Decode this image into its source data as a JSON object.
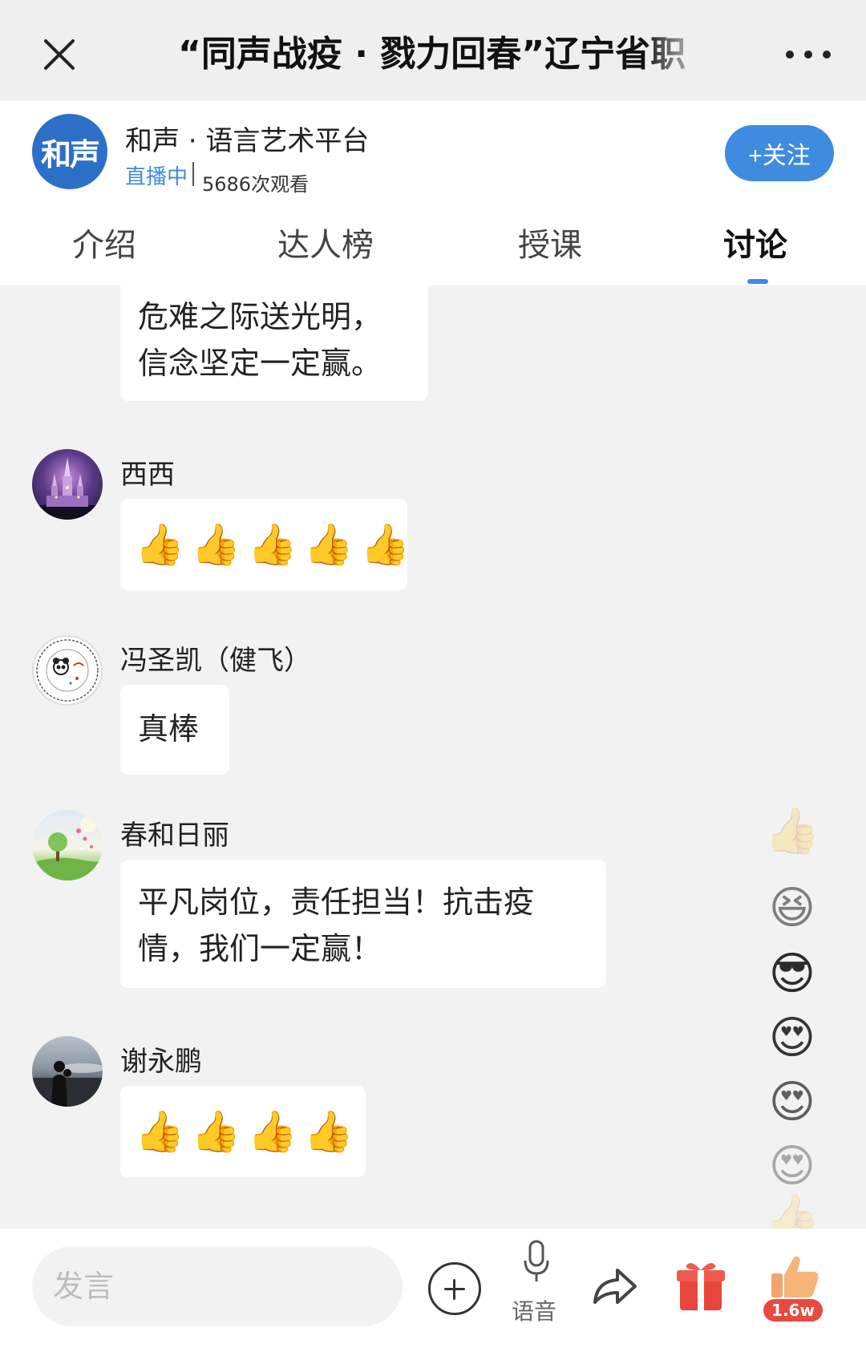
{
  "header": {
    "title": "“同声战疫 · 戮力回春”辽宁省职",
    "close_icon": "close-icon",
    "more_icon": "more-icon"
  },
  "channel": {
    "logo_text": "和声",
    "name": "和声 · 语言艺术平台",
    "live_status": "直播中",
    "views": "5686次观看",
    "follow_label": "+关注",
    "accent_color": "#3e8be0"
  },
  "tabs": [
    {
      "label": "介绍",
      "active": false
    },
    {
      "label": "达人榜",
      "active": false
    },
    {
      "label": "授课",
      "active": false
    },
    {
      "label": "讨论",
      "active": true
    }
  ],
  "messages": [
    {
      "author": "",
      "text_lines": [
        "危难之际送光明，",
        "信念坚定一定赢。"
      ]
    },
    {
      "author": "西西",
      "thumbs_up_count": 5
    },
    {
      "author": "冯圣凯（健飞）",
      "text": "真棒"
    },
    {
      "author": "春和日丽",
      "text_lines": [
        "平凡岗位，责任担当！抗击疫",
        "情，我们一定赢！"
      ]
    },
    {
      "author": "谢永鹏",
      "thumbs_up_count": 4
    }
  ],
  "reactions": [
    "thumbs-up",
    "laughing",
    "sunglasses",
    "heart-eyes",
    "heart-eyes",
    "heart-eyes",
    "thumbs-up"
  ],
  "bottom_bar": {
    "input_placeholder": "发言",
    "voice_label": "语音",
    "like_count": "1.6w",
    "gift_color": "#e8463c"
  }
}
